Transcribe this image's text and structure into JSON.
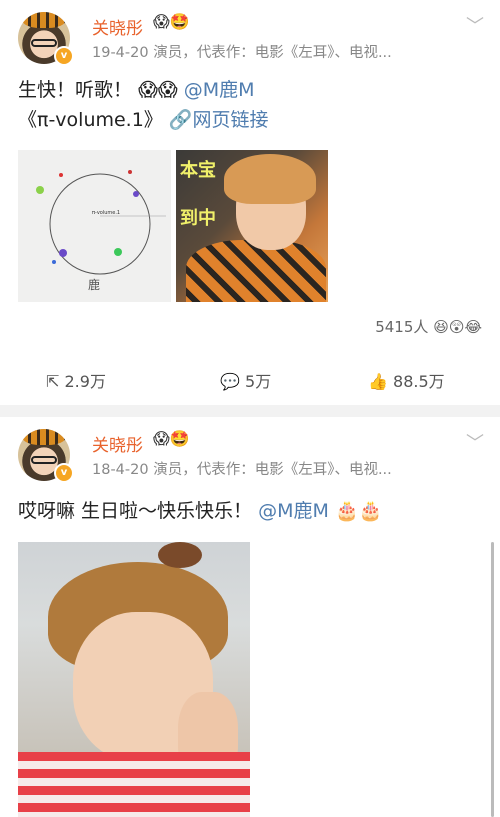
{
  "posts": [
    {
      "author": "关晓彤",
      "badges": "😱🤩",
      "verified_mark": "v",
      "meta": "19-4-20  演员，代表作：电影《左耳》、电视...",
      "line1_text": "生快！听歌！",
      "line1_emoji": "😱😱",
      "mention": "@M鹿M",
      "line2_title": "《π-volume.1》",
      "link_icon": "link-icon",
      "link_text": "网页链接",
      "image1_caption": "π-volume.1",
      "image1_signature": "鹿",
      "image2_scribble_a": "本宝",
      "image2_scribble_b": "到中",
      "likes_count": "5415人",
      "likes_emoji": "😆😲😂",
      "actions": {
        "repost": "2.9万",
        "comment": "5万",
        "like": "88.5万"
      }
    },
    {
      "author": "关晓彤",
      "badges": "😱🤩",
      "verified_mark": "v",
      "meta": "18-4-20  演员，代表作：电影《左耳》、电视...",
      "line1_text": "哎呀嘛 生日啦～快乐快乐！",
      "mention": "@M鹿M",
      "line1_emoji": "🎂🎂"
    }
  ],
  "colors": {
    "author": "#e8622c",
    "mention": "#507daf",
    "meta": "#888888",
    "separator": "#f2f2f2"
  }
}
